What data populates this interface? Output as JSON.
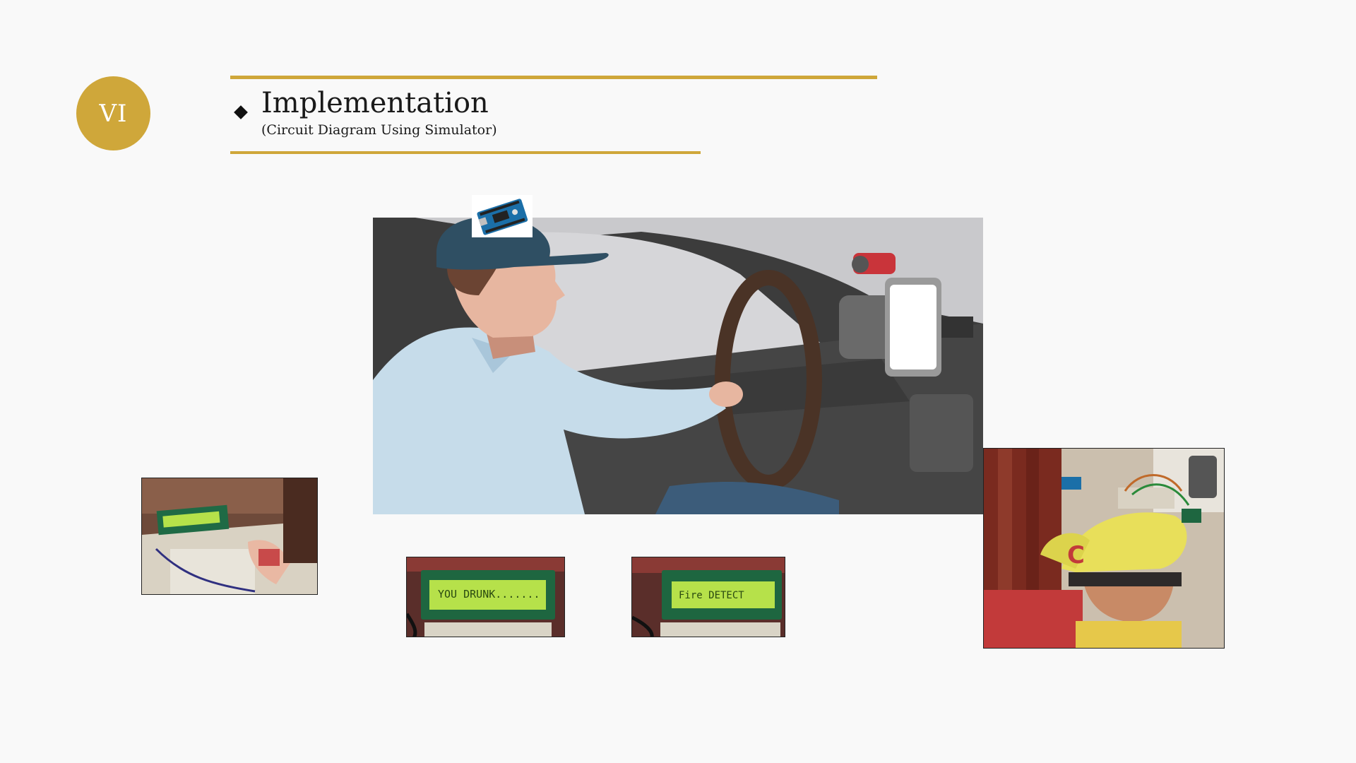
{
  "slide": {
    "section_number": "VI",
    "title": "Implementation",
    "subtitle": "(Circuit Diagram Using Simulator)"
  },
  "images": {
    "main": {
      "name": "driver-in-car-illustration"
    },
    "arduino": {
      "name": "arduino-board-image"
    },
    "left": {
      "name": "lcd-prototype-photo"
    },
    "mid1": {
      "name": "lcd-you-drunk-photo",
      "lcd_text": "YOU DRUNK......."
    },
    "mid2": {
      "name": "lcd-fire-detect-photo",
      "lcd_text": "Fire DETECT"
    },
    "right": {
      "name": "helmet-cap-prototype-photo"
    }
  },
  "colors": {
    "accent": "#cfa73a",
    "background": "#f9f9f9",
    "lcd_green": "#b6e14a"
  }
}
